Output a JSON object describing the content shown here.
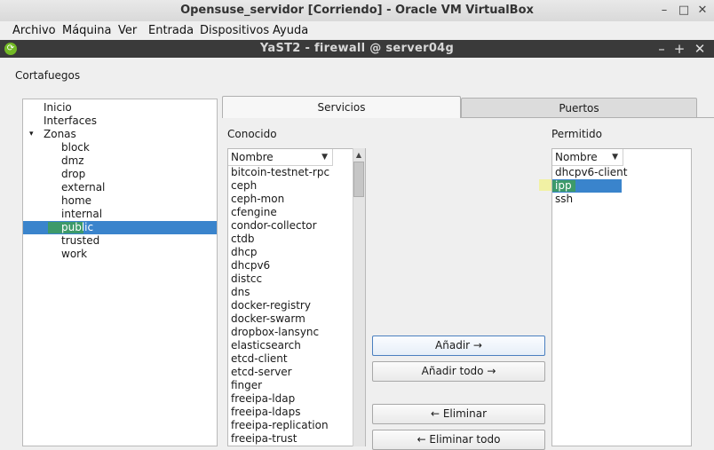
{
  "host_window": {
    "title": "Opensuse_servidor [Corriendo] - Oracle VM VirtualBox",
    "controls": {
      "minimize": "–",
      "maximize": "□",
      "close": "✕"
    }
  },
  "menubar": [
    "Archivo",
    "Máquina",
    "Ver",
    "Entrada",
    "Dispositivos",
    "Ayuda"
  ],
  "yast_window": {
    "title": "YaST2 - firewall @ server04g",
    "controls": {
      "minimize": "–",
      "maximize": "+",
      "close": "✕"
    }
  },
  "page_title": "Cortafuegos",
  "tree": {
    "items": [
      {
        "label": "Inicio",
        "level": 0
      },
      {
        "label": "Interfaces",
        "level": 0
      },
      {
        "label": "Zonas",
        "level": 0,
        "expander": "▾"
      },
      {
        "label": "block",
        "level": 1
      },
      {
        "label": "dmz",
        "level": 1
      },
      {
        "label": "drop",
        "level": 1
      },
      {
        "label": "external",
        "level": 1
      },
      {
        "label": "home",
        "level": 1
      },
      {
        "label": "internal",
        "level": 1
      },
      {
        "label": "public",
        "level": 1,
        "selected": true
      },
      {
        "label": "trusted",
        "level": 1
      },
      {
        "label": "work",
        "level": 1
      }
    ]
  },
  "tabs": {
    "services": "Servicios",
    "ports": "Puertos"
  },
  "known": {
    "label": "Conocido",
    "column": "Nombre",
    "items": [
      "bitcoin-testnet-rpc",
      "ceph",
      "ceph-mon",
      "cfengine",
      "condor-collector",
      "ctdb",
      "dhcp",
      "dhcpv6",
      "distcc",
      "dns",
      "docker-registry",
      "docker-swarm",
      "dropbox-lansync",
      "elasticsearch",
      "etcd-client",
      "etcd-server",
      "finger",
      "freeipa-ldap",
      "freeipa-ldaps",
      "freeipa-replication",
      "freeipa-trust"
    ]
  },
  "allowed": {
    "label": "Permitido",
    "column": "Nombre",
    "items": [
      "dhcpv6-client",
      "ipp",
      "ssh"
    ],
    "selected_index": 1
  },
  "buttons": {
    "add": "Añadir →",
    "add_all": "Añadir todo →",
    "remove": "← Eliminar",
    "remove_all": "← Eliminar todo"
  },
  "colors": {
    "selection": "#3a84cc",
    "yast_titlebar": "#3a3a3a",
    "yast_logo": "#73ba25"
  }
}
